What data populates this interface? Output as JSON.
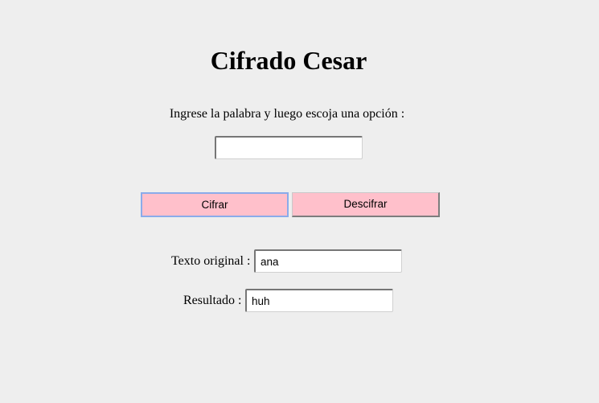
{
  "page": {
    "title": "Cifrado Cesar",
    "prompt": "Ingrese la palabra y luego escoja una opción :"
  },
  "input": {
    "value": ""
  },
  "buttons": {
    "cifrar": "Cifrar",
    "descifrar": "Descifrar"
  },
  "output": {
    "original_label": "Texto original :",
    "original_value": "ana",
    "result_label": "Resultado :",
    "result_value": "huh"
  },
  "colors": {
    "background": "#eeeeee",
    "button": "#ffc0cb",
    "focus_border": "#8aabea"
  }
}
